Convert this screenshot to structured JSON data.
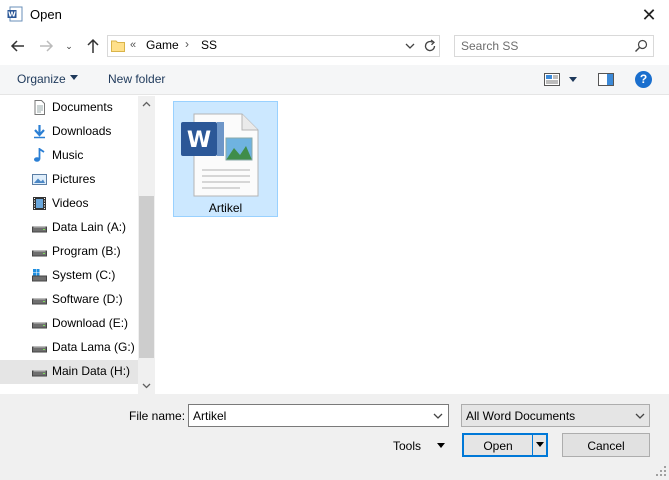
{
  "window": {
    "title": "Open",
    "close_glyph": "✕"
  },
  "nav": {
    "recent_glyph": "⌄"
  },
  "address": {
    "chevrons": "«",
    "crumbs": [
      "Game",
      "SS"
    ],
    "separator": "›"
  },
  "search": {
    "placeholder": "Search SS"
  },
  "toolbar": {
    "organize": "Organize",
    "new_folder": "New folder",
    "help": "?"
  },
  "sidebar": {
    "items": [
      {
        "label": "Documents",
        "icon": "documents-icon"
      },
      {
        "label": "Downloads",
        "icon": "downloads-icon"
      },
      {
        "label": "Music",
        "icon": "music-icon"
      },
      {
        "label": "Pictures",
        "icon": "pictures-icon"
      },
      {
        "label": "Videos",
        "icon": "videos-icon"
      },
      {
        "label": "Data Lain (A:)",
        "icon": "drive-icon"
      },
      {
        "label": "Program (B:)",
        "icon": "drive-icon"
      },
      {
        "label": "System (C:)",
        "icon": "system-drive-icon"
      },
      {
        "label": "Software (D:)",
        "icon": "drive-icon"
      },
      {
        "label": "Download (E:)",
        "icon": "drive-icon"
      },
      {
        "label": "Data Lama (G:)",
        "icon": "drive-icon"
      },
      {
        "label": "Main Data (H:)",
        "icon": "drive-icon",
        "selected": true
      }
    ]
  },
  "files": [
    {
      "name": "Artikel",
      "icon": "word-document-icon",
      "selected": true
    }
  ],
  "bottom": {
    "file_name_label": "File name:",
    "file_name_value": "Artikel",
    "file_type_value": "All Word Documents",
    "tools_label": "Tools",
    "open_label": "Open",
    "cancel_label": "Cancel"
  },
  "colors": {
    "accent": "#0078d7",
    "selection": "#cce8ff",
    "link_text": "#1e395b"
  }
}
